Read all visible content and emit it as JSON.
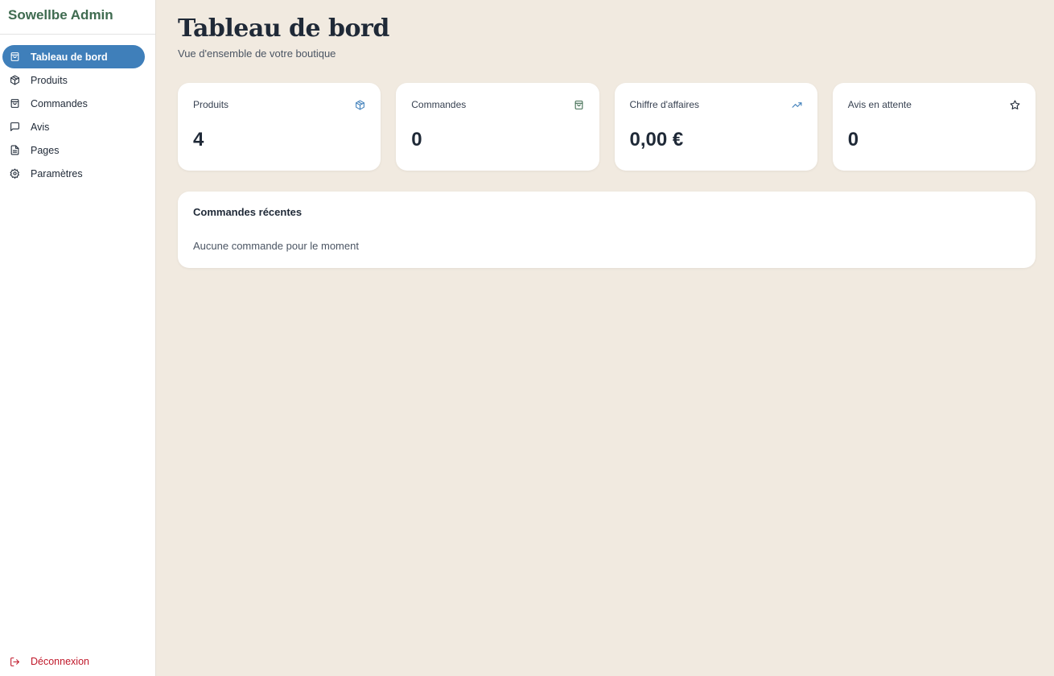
{
  "sidebar": {
    "brand": "Sowellbe Admin",
    "items": [
      {
        "label": "Tableau de bord",
        "icon": "shopping-bag-icon"
      },
      {
        "label": "Produits",
        "icon": "package-icon"
      },
      {
        "label": "Commandes",
        "icon": "shopping-bag-icon"
      },
      {
        "label": "Avis",
        "icon": "message-square-icon"
      },
      {
        "label": "Pages",
        "icon": "file-text-icon"
      },
      {
        "label": "Paramètres",
        "icon": "settings-gear-icon"
      }
    ],
    "logout_label": "Déconnexion"
  },
  "header": {
    "title": "Tableau de bord",
    "subtitle": "Vue d'ensemble de votre boutique"
  },
  "stats": [
    {
      "label": "Produits",
      "value": "4",
      "icon": "package-icon"
    },
    {
      "label": "Commandes",
      "value": "0",
      "icon": "shopping-bag-icon"
    },
    {
      "label": "Chiffre d'affaires",
      "value": "0,00 €",
      "icon": "trending-up-icon"
    },
    {
      "label": "Avis en attente",
      "value": "0",
      "icon": "star-icon"
    }
  ],
  "recent_orders": {
    "title": "Commandes récentes",
    "empty_text": "Aucune commande pour le moment"
  },
  "colors": {
    "accent": "#3f7fba",
    "brand": "#3f6b50",
    "background": "#f1eae0",
    "logout": "#c0182a"
  }
}
